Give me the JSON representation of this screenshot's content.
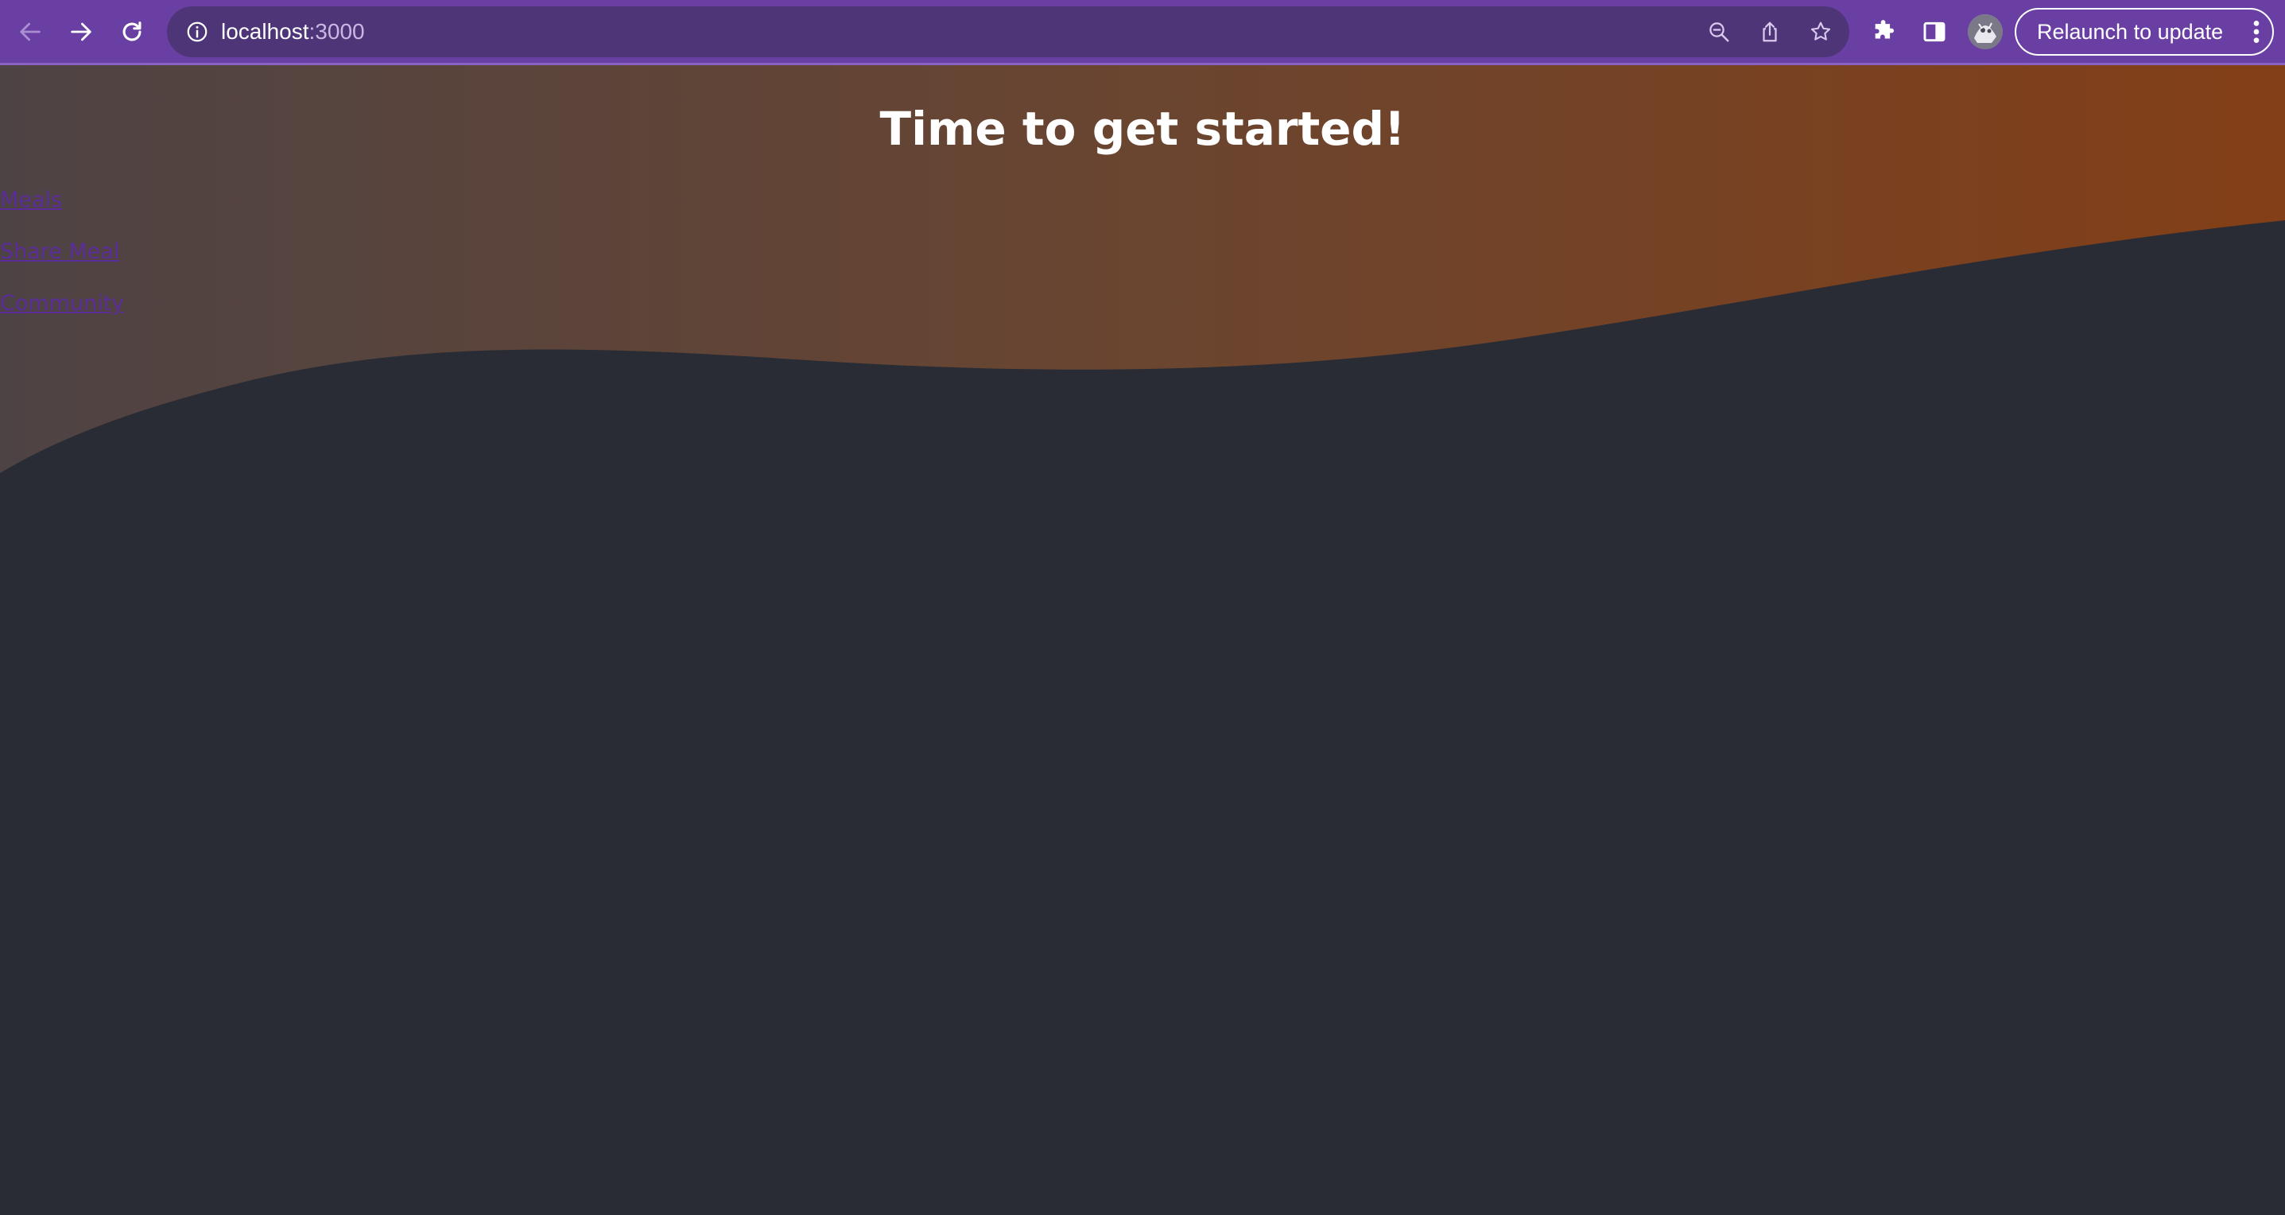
{
  "browser": {
    "url_host": "localhost",
    "url_port": ":3000",
    "relaunch_label": "Relaunch to update",
    "colors": {
      "toolbar": "#6a3fa3",
      "omnibox": "#4d3578"
    }
  },
  "page": {
    "title": "Time to get started!",
    "nav": [
      {
        "label": "Meals"
      },
      {
        "label": "Share Meal"
      },
      {
        "label": "Community"
      }
    ],
    "colors": {
      "background": "#292c34",
      "hero_gradient_start": "#4e4344",
      "hero_gradient_end": "#833f17",
      "link": "#5b2c9a",
      "title": "#ffffff"
    }
  }
}
